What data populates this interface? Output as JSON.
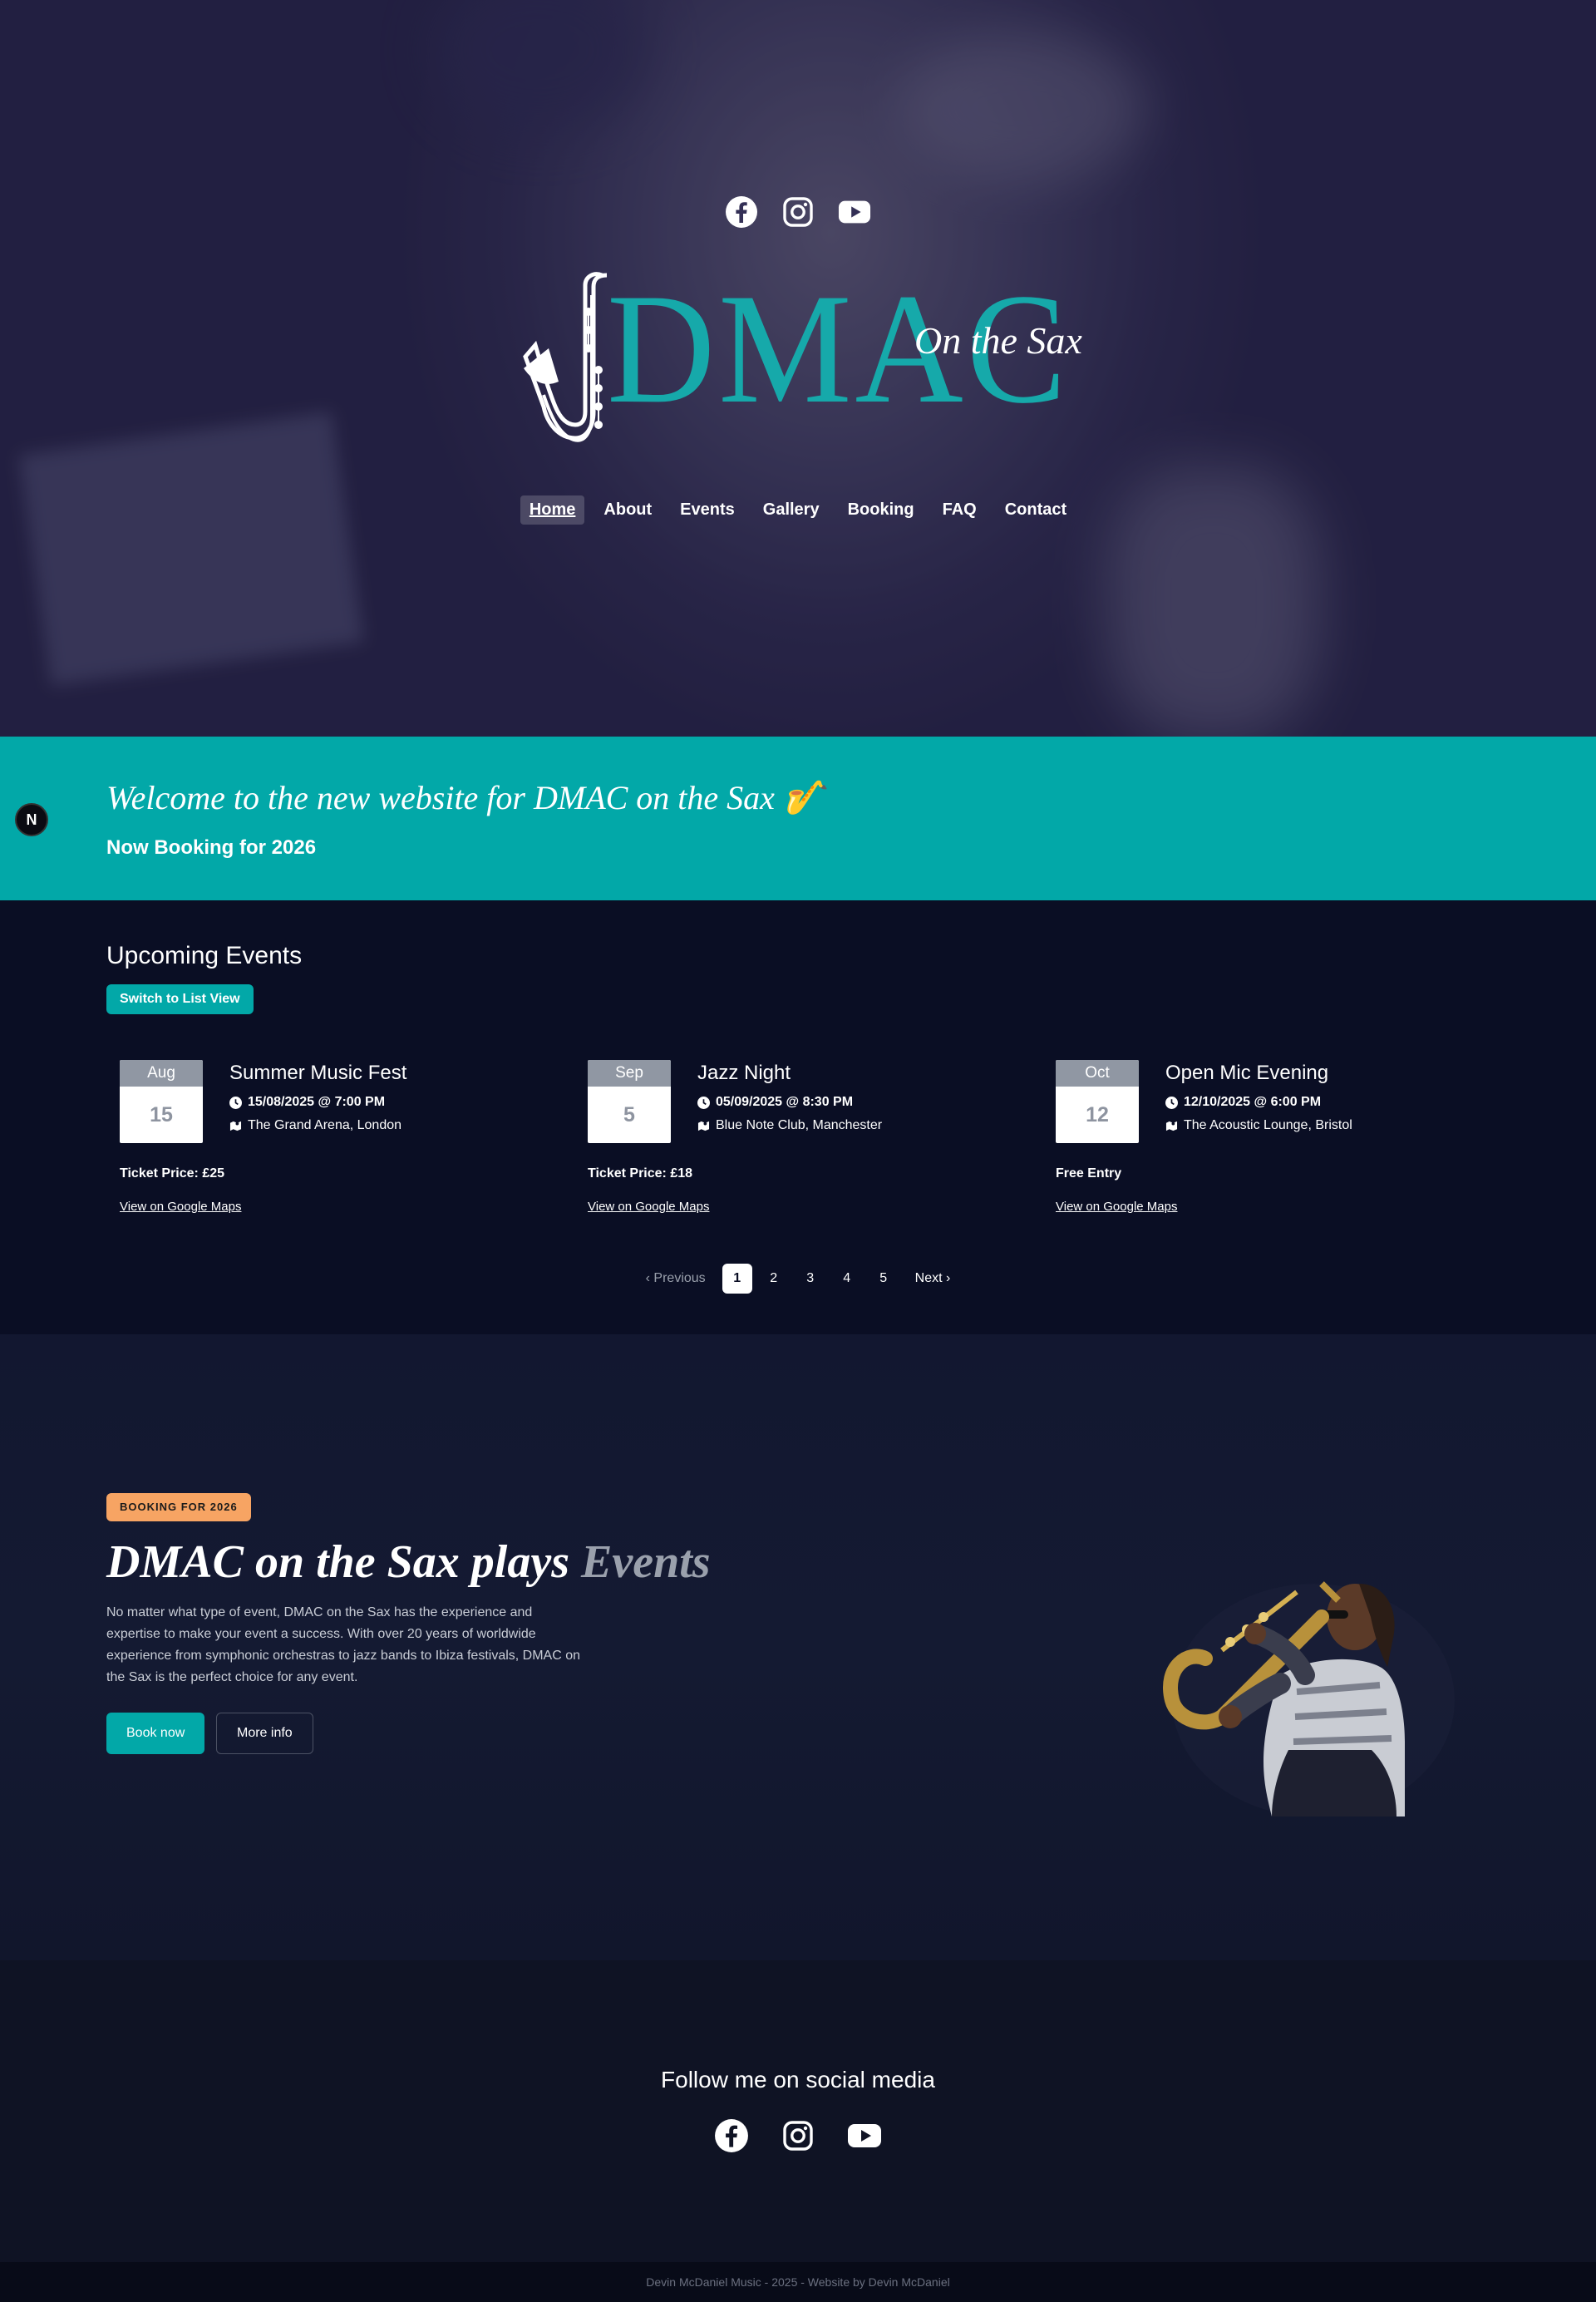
{
  "brand": {
    "logo_word": "DMAC",
    "logo_sub": "On the Sax",
    "accent": "#02a8a8"
  },
  "hero": {
    "social_icons": [
      "facebook-icon",
      "instagram-icon",
      "youtube-icon"
    ]
  },
  "nav": {
    "items": [
      "Home",
      "About",
      "Events",
      "Gallery",
      "Booking",
      "FAQ",
      "Contact"
    ],
    "active": "Home"
  },
  "welcome": {
    "headline": "Welcome to the new website for DMAC on the Sax 🎷",
    "subline": "Now Booking for 2026"
  },
  "n_badge": "N",
  "events": {
    "heading": "Upcoming Events",
    "switch_label": "Switch to List View",
    "items": [
      {
        "month": "Aug",
        "day": "15",
        "title": "Summer Music Fest",
        "datetime": "15/08/2025 @ 7:00 PM",
        "venue": "The Grand Arena, London",
        "price": "Ticket Price: £25",
        "map_link": "View on Google Maps"
      },
      {
        "month": "Sep",
        "day": "5",
        "title": "Jazz Night",
        "datetime": "05/09/2025 @ 8:30 PM",
        "venue": "Blue Note Club, Manchester",
        "price": "Ticket Price: £18",
        "map_link": "View on Google Maps"
      },
      {
        "month": "Oct",
        "day": "12",
        "title": "Open Mic Evening",
        "datetime": "12/10/2025 @ 6:00 PM",
        "venue": "The Acoustic Lounge, Bristol",
        "price": "Free Entry",
        "map_link": "View on Google Maps"
      }
    ],
    "pagination": {
      "prev": "Previous",
      "pages": [
        "1",
        "2",
        "3",
        "4",
        "5"
      ],
      "current": "1",
      "next": "Next"
    }
  },
  "promo": {
    "badge": "BOOKING FOR 2026",
    "title_main": "DMAC on the Sax plays",
    "title_accent": "Events",
    "body": "No matter what type of event, DMAC on the Sax has the experience and expertise to make your event a success. With over 20 years of worldwide experience from symphonic orchestras to jazz bands to Ibiza festivals, DMAC on the Sax is the perfect choice for any event.",
    "book_label": "Book now",
    "info_label": "More info"
  },
  "follow": {
    "heading": "Follow me on social media",
    "icons": [
      "facebook-icon",
      "instagram-icon",
      "youtube-icon"
    ]
  },
  "footer": {
    "text": "Devin McDaniel Music - 2025 - Website by Devin McDaniel"
  }
}
